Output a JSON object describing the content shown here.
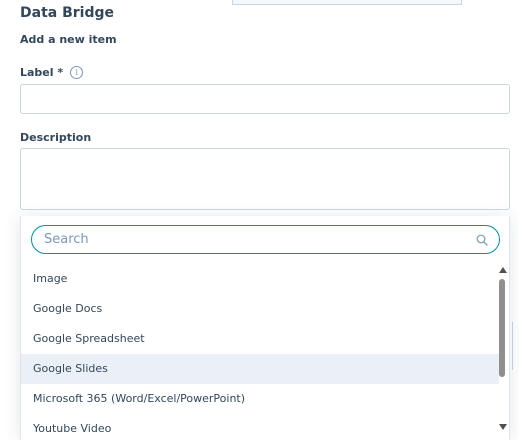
{
  "app": {
    "title": "Data Bridge"
  },
  "form": {
    "heading": "Add a new item",
    "label_field": {
      "label": "Label *",
      "info_icon": "info-icon",
      "value": ""
    },
    "description_field": {
      "label": "Description",
      "value": ""
    }
  },
  "dropdown": {
    "search": {
      "placeholder": "Search",
      "value": "",
      "icon": "search-icon"
    },
    "options": [
      {
        "label": "Image"
      },
      {
        "label": "Google Docs"
      },
      {
        "label": "Google Spreadsheet"
      },
      {
        "label": "Google Slides",
        "highlighted": true
      },
      {
        "label": "Microsoft 365 (Word/Excel/PowerPoint)"
      },
      {
        "label": "Youtube Video"
      }
    ]
  },
  "colors": {
    "focus_accent": "#0091ae",
    "highlight_row": "#eaf0f6",
    "text": "#33475b",
    "border": "#cbd6e2"
  }
}
